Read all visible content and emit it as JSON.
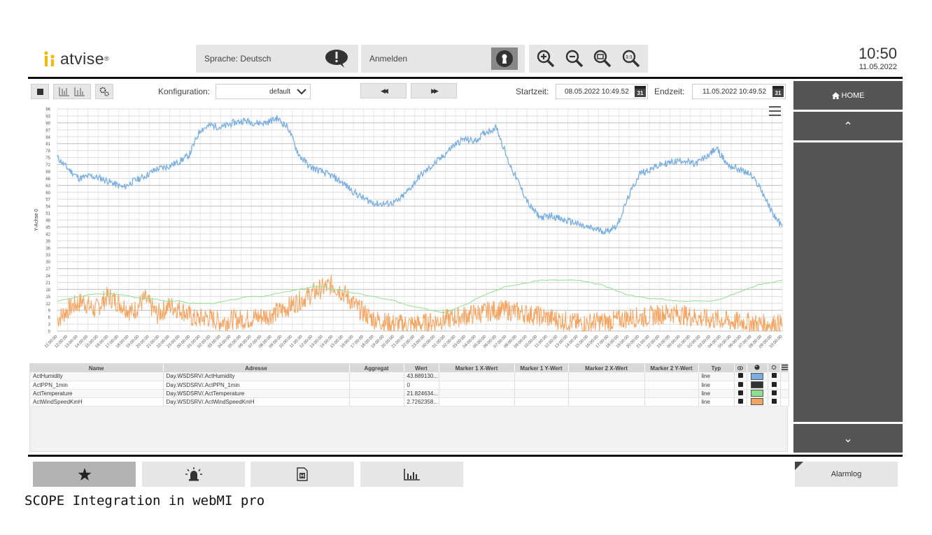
{
  "header": {
    "logo_text": "atvise",
    "logo_reg": "®",
    "language_label": "Sprache: Deutsch",
    "login_label": "Anmelden",
    "time": "10:50",
    "date": "11.05.2022",
    "icons": [
      "speech-bubble-exclamation-icon",
      "keyhole-icon",
      "zoom-in-icon",
      "zoom-out-icon",
      "zoom-fit-icon",
      "zoom-reset-icon"
    ],
    "zoom_reset_label": "1:1"
  },
  "toolbar": {
    "config_label": "Konfiguration:",
    "config_value": "default",
    "start_label": "Startzeit:",
    "start_value": "08.05.2022 10:49.52",
    "end_label": "Endzeit:",
    "end_value": "11.05.2022 10:49.52",
    "calendar_day": "31",
    "rewind_glyph": "◀◀",
    "forward_glyph": "▶▶"
  },
  "right_nav": {
    "home_label": "HOME",
    "up_glyph": "⌃",
    "down_glyph": "⌄",
    "alarmlog_label": "Alarmlog"
  },
  "chart_data": {
    "type": "line",
    "ylabel": "Y-Achse 0",
    "ylim": [
      0,
      96
    ],
    "yticks": [
      0,
      3,
      6,
      9,
      12,
      15,
      18,
      21,
      24,
      27,
      30,
      33,
      36,
      39,
      42,
      45,
      48,
      51,
      54,
      57,
      60,
      63,
      66,
      69,
      72,
      75,
      78,
      81,
      84,
      87,
      90,
      93,
      96
    ],
    "xticks": [
      "11:00:00",
      "12:00:00",
      "13:00:00",
      "14:00:00",
      "15:00:00",
      "16:00:00",
      "17:00:00",
      "18:00:00",
      "19:00:00",
      "20:00:00",
      "21:00:00",
      "22:00:00",
      "23:00:00",
      "00:00:00",
      "01:00:00",
      "02:00:00",
      "03:00:00",
      "04:00:00",
      "05:00:00",
      "06:00:00",
      "07:00:00",
      "08:00:00",
      "09:00:00",
      "10:00:00",
      "11:00:00",
      "12:00:00",
      "13:00:00",
      "14:00:00",
      "15:00:00",
      "16:00:00",
      "17:00:00",
      "18:00:00",
      "19:00:00",
      "20:00:00",
      "21:00:00",
      "22:00:00",
      "23:00:00",
      "00:00:00",
      "01:00:00",
      "02:00:00",
      "03:00:00",
      "04:00:00",
      "05:00:00",
      "06:00:00",
      "07:00:00",
      "08:00:00",
      "09:00:00",
      "10:00:00",
      "11:00:00",
      "12:00:00",
      "13:00:00",
      "14:00:00",
      "15:00:00",
      "16:00:00",
      "17:00:00",
      "18:00:00",
      "19:00:00",
      "20:00:00",
      "21:00:00",
      "22:00:00",
      "23:00:00",
      "00:00:00",
      "01:00:00",
      "02:00:00",
      "03:00:00",
      "04:00:00",
      "05:00:00",
      "06:00:00",
      "07:00:00",
      "08:00:00",
      "09:00:00",
      "10:00:00"
    ],
    "series": [
      {
        "name": "ActHumidity",
        "color": "#7aaee0",
        "values": [
          75,
          70,
          66,
          67,
          66,
          64,
          62,
          65,
          67,
          70,
          71,
          73,
          76,
          87,
          89,
          88,
          90,
          91,
          90,
          90,
          92,
          88,
          76,
          71,
          69,
          67,
          64,
          60,
          57,
          55,
          55,
          56,
          61,
          67,
          71,
          75,
          80,
          83,
          82,
          86,
          88,
          74,
          64,
          54,
          49,
          50,
          48,
          47,
          45,
          44,
          43,
          46,
          58,
          68,
          70,
          72,
          73,
          74,
          72,
          75,
          79,
          72,
          70,
          68,
          62,
          52,
          45
        ]
      },
      {
        "name": "ActPPN_1min",
        "color": "#333333",
        "values": [
          0
        ]
      },
      {
        "name": "ActTemperature",
        "color": "#8ee08e",
        "values": [
          13,
          14,
          15,
          16,
          16,
          16,
          15,
          14,
          14,
          13,
          13,
          12,
          12,
          12,
          13,
          14,
          15,
          15,
          16,
          17,
          18,
          19,
          19,
          18,
          17,
          16,
          15,
          14,
          13,
          11,
          10,
          9,
          8,
          10,
          12,
          15,
          17,
          19,
          20,
          21,
          22,
          22,
          22,
          22,
          21,
          20,
          18,
          16,
          15,
          14,
          14,
          13,
          13,
          13,
          13,
          14,
          16,
          18,
          20,
          21,
          22
        ]
      },
      {
        "name": "ActWindSpeedKmH",
        "color": "#f4a460",
        "values": [
          5,
          10,
          13,
          9,
          15,
          12,
          8,
          14,
          7,
          11,
          9,
          5,
          6,
          4,
          5,
          5,
          6,
          7,
          9,
          12,
          15,
          18,
          20,
          16,
          10,
          6,
          4,
          3,
          3,
          3,
          4,
          5,
          6,
          7,
          8,
          9,
          9,
          8,
          7,
          6,
          5,
          4,
          3,
          4,
          4,
          5,
          6,
          6,
          7,
          8,
          7,
          6,
          5,
          5,
          4,
          4,
          3,
          3,
          3
        ]
      }
    ]
  },
  "table": {
    "headers": [
      "Name",
      "Adresse",
      "Aggregat",
      "Wert",
      "Marker 1 X-Wert",
      "Marker 1 Y-Wert",
      "Marker 2 X-Wert",
      "Marker 2 Y-Wert",
      "Typ"
    ],
    "rows": [
      {
        "name": "ActHumidity",
        "address": "Day.WSDSRV/.ActHumidity",
        "aggregate": "",
        "value": "43.889130...",
        "type": "line",
        "color": "#7aaee0"
      },
      {
        "name": "ActPPN_1min",
        "address": "Day.WSDSRV/.ActPPN_1min",
        "aggregate": "",
        "value": "0",
        "type": "line",
        "color": "#333333"
      },
      {
        "name": "ActTemperature",
        "address": "Day.WSDSRV/.ActTemperature",
        "aggregate": "",
        "value": "21.824634...",
        "type": "line",
        "color": "#8ee08e"
      },
      {
        "name": "ActWindSpeedKmH",
        "address": "Day.WSDSRV/.ActWindSpeedKmH",
        "aggregate": "",
        "value": "2.7262358...",
        "type": "line",
        "color": "#f4a460"
      }
    ]
  },
  "bottom_nav": {
    "icons": [
      "star-icon",
      "alarm-siren-icon",
      "history-document-icon",
      "bar-chart-icon"
    ]
  },
  "caption": "SCOPE Integration in webMI pro"
}
